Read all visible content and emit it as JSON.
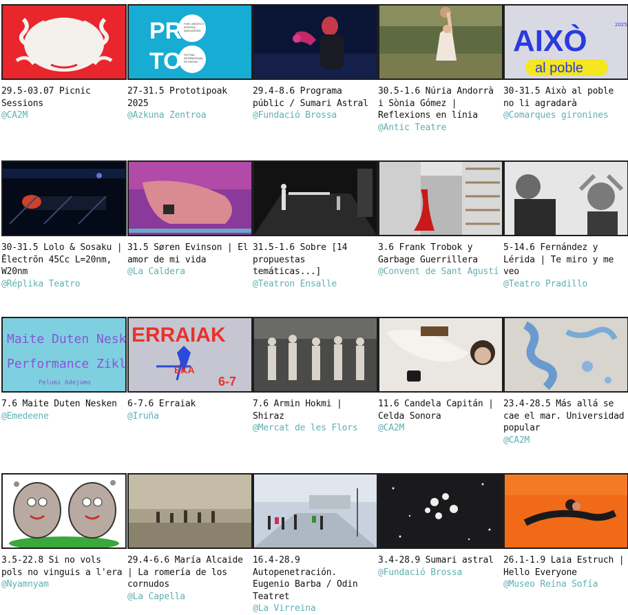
{
  "colors": {
    "venue": "#5fb0b2",
    "text": "#111111",
    "border": "#1e1e1e"
  },
  "cards": [
    {
      "title": "29.5-03.07 Picnic Sessions",
      "venue": "@CA2M",
      "image": "red-white-ornament-illustration"
    },
    {
      "title": "27-31.5 Prototipoak 2025",
      "venue": "@Azkuna Zentroa",
      "image": "proto-cyan-poster",
      "image_text": [
        "PRO",
        "TO",
        "FORO ARTISTICO",
        "ZENTROA",
        "NAZIOARTEKO",
        "FESTIVAL",
        "ARTEKO",
        "INTERNATIONAL",
        "DE NUEVAS"
      ]
    },
    {
      "title": "29.4-8.6 Programa públic / Sumari Astral",
      "venue": "@Fundació Brossa",
      "image": "performer-red-light"
    },
    {
      "title": "30.5-1.6 Núria Andorrà i Sònia Gómez | Reflexions en línia",
      "venue": "@Antic Teatre",
      "image": "dancer-in-grass"
    },
    {
      "title": "30-31.5 Això al poble no li agradarà",
      "venue": "@Comarques gironines",
      "image": "aixo-al-poble-poster",
      "image_text": [
        "AIXÒ",
        "al poble",
        "2025"
      ]
    },
    {
      "title": "30-31.5 Lolo & Sosaku | Ēlectrōn 45Cc L=20nm, W20nm",
      "venue": "@Réplika Teatro",
      "image": "dark-stage-machine"
    },
    {
      "title": "31.5 Søren Evinson | El amor de mi vida",
      "venue": "@La Caldera",
      "image": "pink-purple-body"
    },
    {
      "title": "31.5-1.6 Sobre [14 propuestas temáticas...]",
      "venue": "@Teatron Ensalle",
      "image": "dark-stage-performers"
    },
    {
      "title": "3.6 Frank Trobok y Garbage Guerrillera",
      "venue": "@Convent de Sant Agustí",
      "image": "collage-red-figure"
    },
    {
      "title": "5-14.6 Fernández y Lérida | Te miro y me veo",
      "venue": "@Teatro Pradillo",
      "image": "bw-two-faces"
    },
    {
      "title": "7.6 Maite Duten Nesken",
      "venue": "@Emedeene",
      "image": "maite-poster",
      "image_text": [
        "Maite Duten Nesken",
        "Performance Zikloa",
        "Pelumi Adejumo"
      ]
    },
    {
      "title": "6-7.6 Erraiak",
      "venue": "@Iruña",
      "image": "erraiak-poster",
      "image_text": [
        "ERRAIAK",
        "EKA",
        "6-7"
      ]
    },
    {
      "title": "7.6 Armin Hokmi | Shiraz",
      "venue": "@Mercat de les Flors",
      "image": "dancers-in-row"
    },
    {
      "title": "11.6 Candela Capitán | Celda Sonora",
      "venue": "@CA2M",
      "image": "performer-on-floor"
    },
    {
      "title": "23.4-28.5 Más allá se cae el mar. Universidad popular",
      "venue": "@CA2M",
      "image": "peeling-blue-wall"
    },
    {
      "title": "3.5-22.8 Si no vols pols no vinguis a l'era",
      "venue": "@Nyamnyam",
      "image": "cartoon-armwrestle"
    },
    {
      "title": "29.4-6.6 María Alcaide | La romería de los cornudos",
      "venue": "@La Capella",
      "image": "dusty-procession"
    },
    {
      "title": "16.4-28.9 Autopenetración. Eugenio Barba / Odin Teatret",
      "venue": "@La Virreina",
      "image": "street-performers"
    },
    {
      "title": "3.4-28.9 Sumari astral",
      "venue": "@Fundació Brossa",
      "image": "star-cluster"
    },
    {
      "title": "26.1-1.9 Laia Estruch | Hello Everyone",
      "venue": "@Museo Reina Sofía",
      "image": "woman-on-orange-floor"
    }
  ]
}
